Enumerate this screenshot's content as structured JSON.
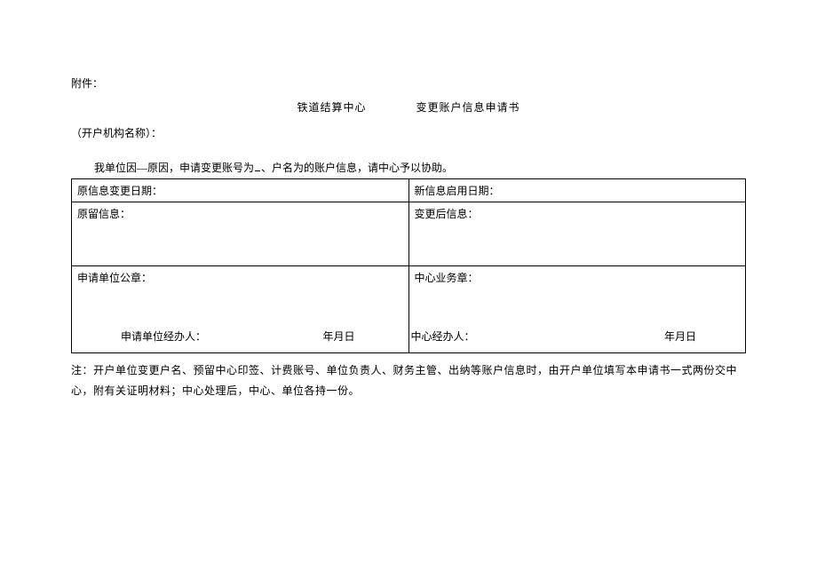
{
  "attachment": "附件：",
  "title_part1": "铁道结算中心",
  "title_part2": "变更账户信息申请书",
  "org_name_label": "（开户机构名称）：",
  "declaration_prefix": "我单位因—原因，申请变更账号为",
  "declaration_suffix": "、户名为的账户信息，请中心予以协助。",
  "row1_left": "原信息变更日期：",
  "row1_right": "新信息启用日期：",
  "row2_left": "原留信息：",
  "row2_right": "变更后信息：",
  "row3_left": "申请单位公章：",
  "row3_right": "中心业务章：",
  "row3_left_handler": "申请单位经办人：",
  "row3_left_date": "年月日",
  "row3_right_handler": "中心经办人：",
  "row3_right_date": "年月日",
  "note": "注：开户单位变更户名、预留中心印签、计费账号、单位负责人、财务主管、出纳等账户信息时，由开户单位填写本申请书一式两份交中心，附有关证明材料；中心处理后，中心、单位各持一份。"
}
